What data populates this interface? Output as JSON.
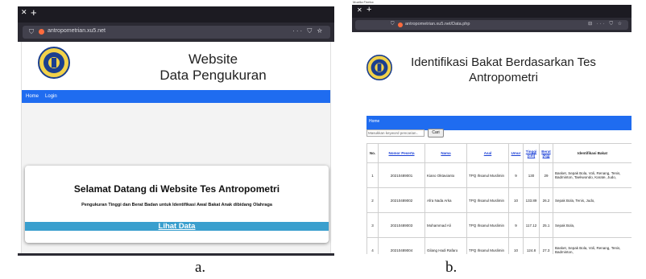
{
  "panel_a": {
    "browser": {
      "url": "antropometrian.xu5.net",
      "actions": "··· ⛉ ☆"
    },
    "site_title_line1": "Website",
    "site_title_line2": "Data Pengukuran",
    "nav": [
      "Home",
      "Login"
    ],
    "welcome": {
      "title": "Selamat Datang di Website Tes Antropometri",
      "subtitle": "Pengukuran Tinggi dan Berat Badan untuk Identifikasi Awal Bakat Anak dibidang Olahraga",
      "button": "Lihat Data"
    },
    "caption": "a."
  },
  "panel_b": {
    "window_title": "Mozilla Firefox",
    "browser": {
      "url": "antropometrian.xu5.net/Data.php",
      "actions": "⊟ ··· ⛉ ☆"
    },
    "site_title_line1": "Identifikasi Bakat Berdasarkan Tes",
    "site_title_line2": "Antropometri",
    "nav": [
      "Home"
    ],
    "search": {
      "placeholder": "Masukkan keyword pencarian..",
      "button": "Cari"
    },
    "table": {
      "headers": [
        "No.",
        "Nomor Peserta",
        "Nama",
        "Asal",
        "Umur",
        "Tinggi (cm)",
        "Berat (Kg)",
        "Identifikasi Bakat"
      ],
      "rows": [
        [
          "1",
          "20210489001",
          "Kiano Oktavianto",
          "TPQ Ihsanul Muslimin",
          "9",
          "130",
          "29",
          "Basket, Sepak Bola, Voli, Renang, Tenis, Badminton, Taekwondo, Karate, Judo,"
        ],
        [
          "2",
          "20210489002",
          "Afra Nada Arka",
          "TPQ Ihsanul Muslimin",
          "10",
          "133.89",
          "26.2",
          "Sepak Bola, Tenis, Judo,"
        ],
        [
          "3",
          "20210489003",
          "Mohammad Ali",
          "TPQ Ihsanul Muslimin",
          "9",
          "117.12",
          "25.1",
          "Sepak Bola,"
        ],
        [
          "4",
          "20210489004",
          "Gilang Hadi Rafaro",
          "TPQ Ihsanul Muslimin",
          "10",
          "124.8",
          "27.3",
          "Basket, Sepak Bola, Voli, Renang, Tenis, Badminton,"
        ]
      ]
    },
    "caption": "b."
  },
  "colors": {
    "nav_blue": "#1f6cf0",
    "button_blue": "#3a9fce",
    "browser_dark": "#1c1b22",
    "link_blue": "#1a3fd6"
  }
}
